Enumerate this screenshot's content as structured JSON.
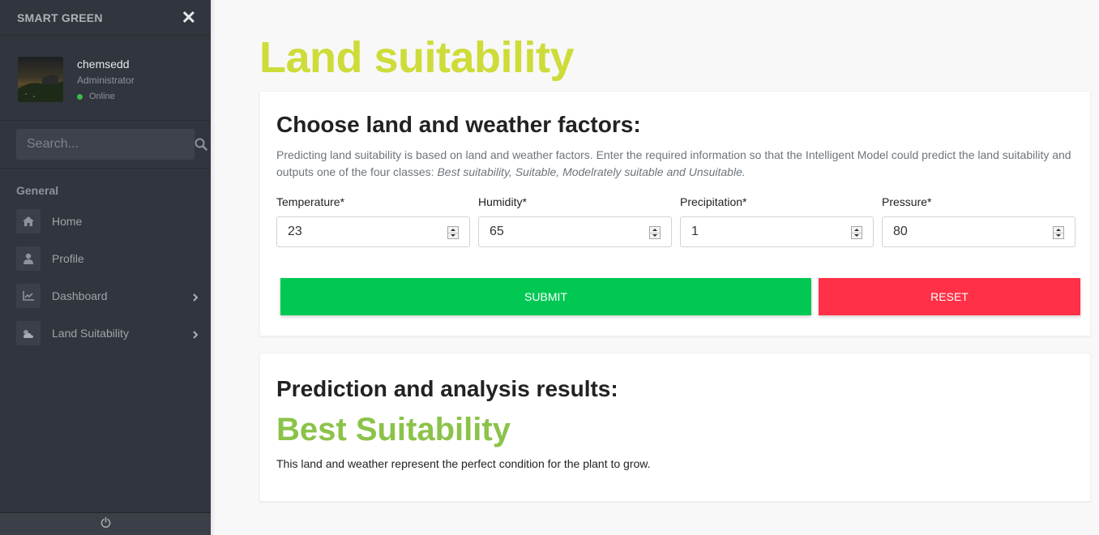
{
  "sidebar": {
    "brand": "SMART GREEN",
    "user": {
      "name": "chemsedd",
      "role": "Administrator",
      "status": "Online"
    },
    "search": {
      "placeholder": "Search..."
    },
    "menu_header": "General",
    "items": [
      {
        "label": "Home",
        "icon": "home-icon"
      },
      {
        "label": "Profile",
        "icon": "user-icon"
      },
      {
        "label": "Dashboard",
        "icon": "chart-icon",
        "has_submenu": true
      },
      {
        "label": "Land Suitability",
        "icon": "weather-icon",
        "has_submenu": true
      }
    ]
  },
  "main": {
    "page_title": "Land suitability",
    "form_card": {
      "title": "Choose land and weather factors:",
      "description_plain": "Predicting land suitability is based on land and weather factors. Enter the required information so that the Intelligent Model could predict the land suitability and outputs one of the four classes: ",
      "description_italic": "Best suitability, Suitable, Modelrately suitable and Unsuitable.",
      "fields": [
        {
          "label": "Temperature*",
          "value": "23"
        },
        {
          "label": "Humidity*",
          "value": "65"
        },
        {
          "label": "Precipitation*",
          "value": "1"
        },
        {
          "label": "Pressure*",
          "value": "80"
        }
      ],
      "submit_label": "SUBMIT",
      "reset_label": "RESET"
    },
    "result_card": {
      "title": "Prediction and analysis results:",
      "result": "Best Suitability",
      "description": "This land and weather represent the perfect condition for the plant to grow."
    }
  },
  "colors": {
    "accent_title": "#cddc39",
    "result_green": "#8bc34a",
    "submit_green": "#00c853",
    "reset_red": "#ff3047",
    "sidebar_bg": "#31353d",
    "status_online": "#3cbb4a"
  }
}
